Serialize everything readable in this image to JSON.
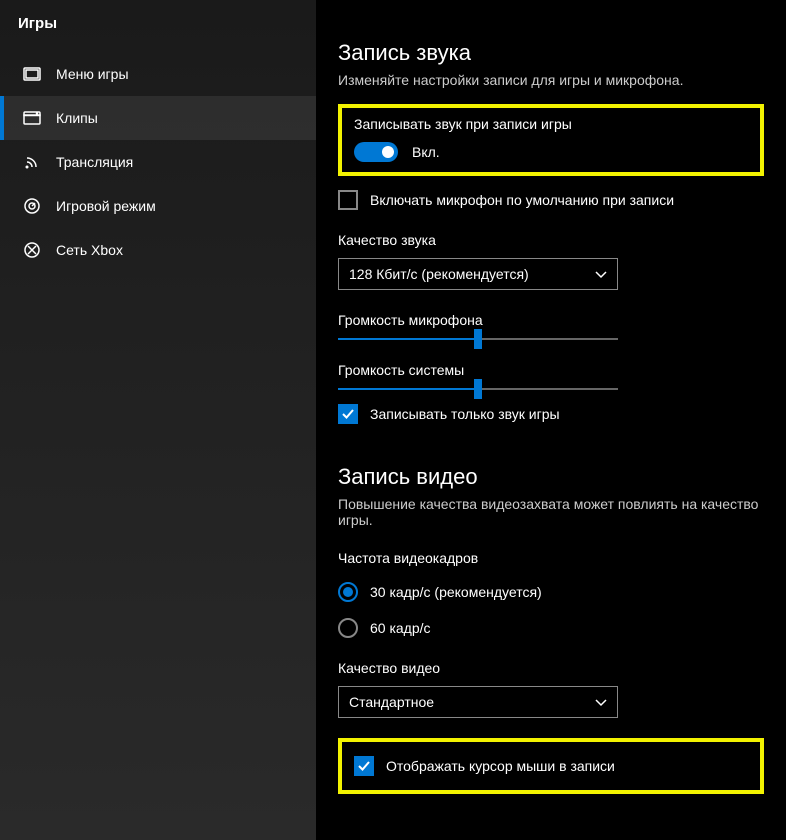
{
  "sidebar": {
    "title": "Игры",
    "items": [
      {
        "label": "Меню игры"
      },
      {
        "label": "Клипы"
      },
      {
        "label": "Трансляция"
      },
      {
        "label": "Игровой режим"
      },
      {
        "label": "Сеть Xbox"
      }
    ]
  },
  "audio": {
    "title": "Запись звука",
    "desc": "Изменяйте настройки записи для игры и микрофона.",
    "record_audio_label": "Записывать звук при записи игры",
    "toggle_state": "Вкл.",
    "mic_default_label": "Включать микрофон по умолчанию при записи",
    "quality_label": "Качество звука",
    "quality_value": "128 Кбит/с (рекомендуется)",
    "mic_volume_label": "Громкость микрофона",
    "mic_volume": 50,
    "sys_volume_label": "Громкость системы",
    "sys_volume": 50,
    "game_only_label": "Записывать только звук игры"
  },
  "video": {
    "title": "Запись видео",
    "desc": "Повышение качества видеозахвата может повлиять на качество игры.",
    "fps_label": "Частота видеокадров",
    "fps30": "30 кадр/с (рекомендуется)",
    "fps60": "60 кадр/с",
    "quality_label": "Качество видео",
    "quality_value": "Стандартное",
    "cursor_label": "Отображать курсор мыши в записи"
  }
}
